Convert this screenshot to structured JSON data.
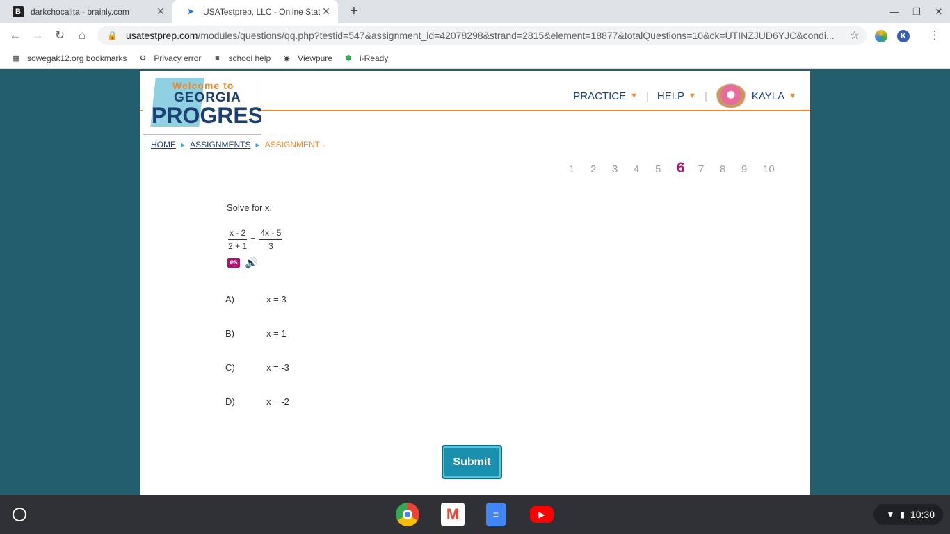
{
  "browser": {
    "tabs": [
      {
        "label": "darkchocalita - brainly.com",
        "favicon": "B"
      },
      {
        "label": "USATestprep, LLC - Online State-S",
        "favicon": "cursor-icon"
      }
    ],
    "new_tab": "+",
    "url_host": "usatestprep.com",
    "url_path": "/modules/questions/qq.php?testid=547&assignment_id=42078298&strand=2815&element=18877&totalQuestions=10&ck=UTINZJUD6YJC&condi...",
    "bookmarks": [
      {
        "label": "sowegak12.org bookmarks",
        "icon": "bookmarks-icon"
      },
      {
        "label": "Privacy error",
        "icon": "privacy-icon"
      },
      {
        "label": "school help",
        "icon": "folder-icon"
      },
      {
        "label": "Viewpure",
        "icon": "globe-icon"
      },
      {
        "label": "i-Ready",
        "icon": "cube-icon"
      }
    ]
  },
  "site": {
    "logo": {
      "welcome": "Welcome to",
      "georgia": "GEORGIA",
      "progress": "PROGRESS"
    },
    "nav": {
      "practice": "PRACTICE",
      "help": "HELP",
      "user": "KAYLA"
    },
    "breadcrumb": {
      "home": "HOME",
      "assignments": "ASSIGNMENTS",
      "current": "ASSIGNMENT -"
    },
    "question_numbers": [
      "1",
      "2",
      "3",
      "4",
      "5",
      "6",
      "7",
      "8",
      "9",
      "10"
    ],
    "active_question": "6",
    "question": {
      "prompt": "Solve for x.",
      "lhs_num": "x - 2",
      "lhs_den": "2 + 1",
      "equals": "=",
      "rhs_num": "4x - 5",
      "rhs_den": "3",
      "es_label": "es"
    },
    "answers": [
      {
        "letter": "A)",
        "text": "x = 3"
      },
      {
        "letter": "B)",
        "text": "x = 1"
      },
      {
        "letter": "C)",
        "text": "x = -3"
      },
      {
        "letter": "D)",
        "text": "x = -2"
      }
    ],
    "submit": "Submit"
  },
  "shelf": {
    "time": "10:30"
  },
  "colors": {
    "accent_orange": "#f08a2a",
    "navy": "#1d4070",
    "magenta": "#b0156e",
    "teal_bg": "#225e6b",
    "submit_blue": "#1a8fae"
  }
}
